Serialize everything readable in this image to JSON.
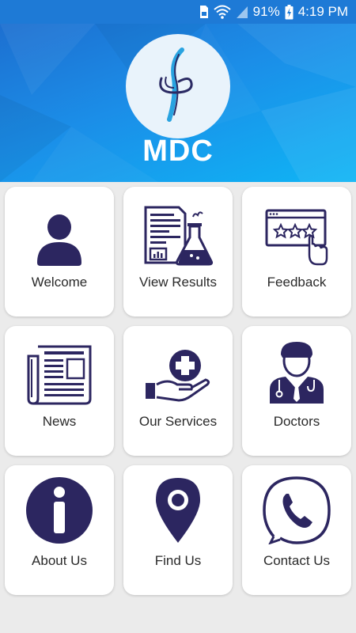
{
  "status_bar": {
    "battery_percent": "91%",
    "time": "4:19 PM",
    "icons": [
      "sim-icon",
      "wifi-icon",
      "signal-icon",
      "battery-icon"
    ]
  },
  "header": {
    "app_name": "MDC",
    "logo": "mdc-logo"
  },
  "colors": {
    "accent": "#1e7ad6",
    "icon": "#2c2660"
  },
  "menu": [
    {
      "label": "Welcome",
      "icon": "user-icon"
    },
    {
      "label": "View Results",
      "icon": "lab-report-icon"
    },
    {
      "label": "Feedback",
      "icon": "rating-icon"
    },
    {
      "label": "News",
      "icon": "newspaper-icon"
    },
    {
      "label": "Our Services",
      "icon": "care-hand-icon"
    },
    {
      "label": "Doctors",
      "icon": "doctor-icon"
    },
    {
      "label": "About Us",
      "icon": "info-icon"
    },
    {
      "label": "Find Us",
      "icon": "location-pin-icon"
    },
    {
      "label": "Contact Us",
      "icon": "phone-icon"
    }
  ]
}
